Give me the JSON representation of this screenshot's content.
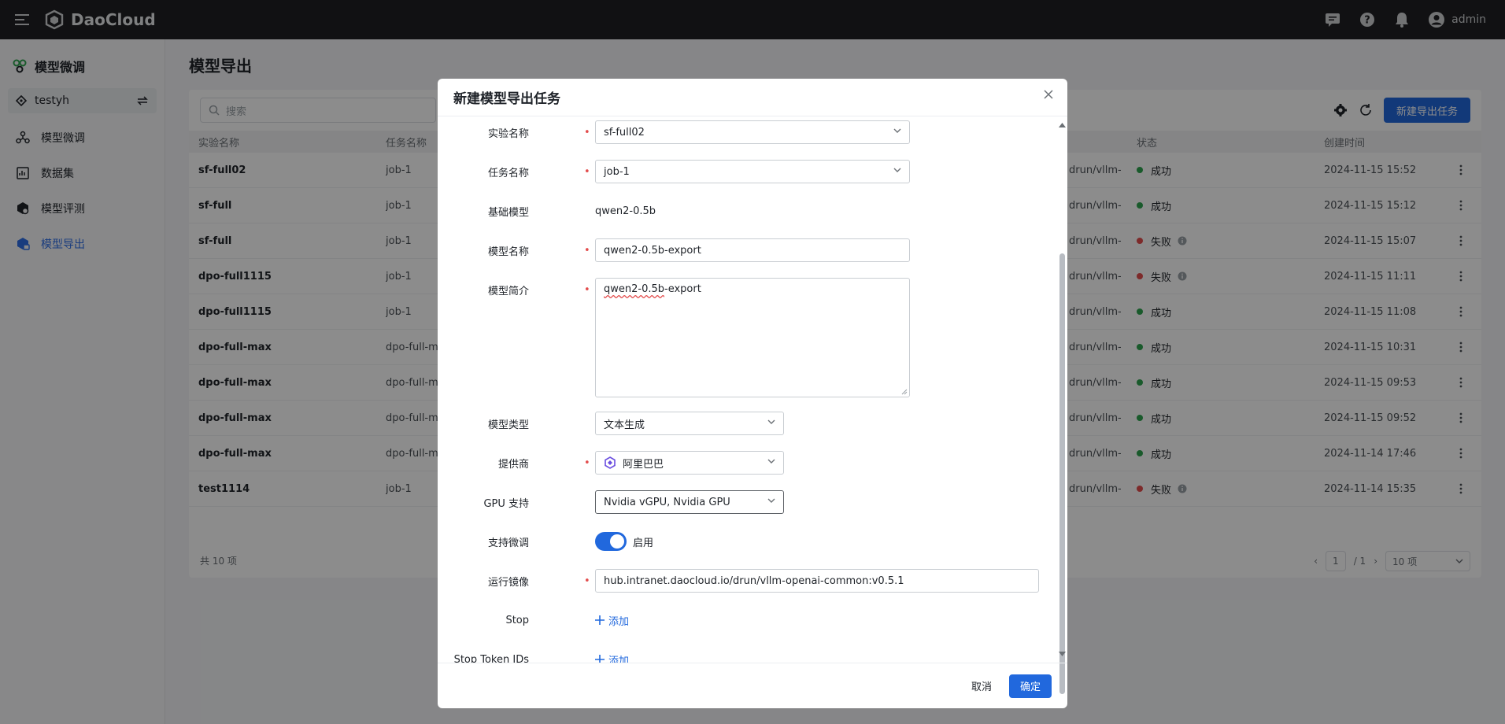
{
  "topbar": {
    "brand": "DaoCloud",
    "user": "admin"
  },
  "sidebar": {
    "title": "模型微调",
    "workspace": "testyh",
    "items": [
      {
        "label": "模型微调"
      },
      {
        "label": "数据集"
      },
      {
        "label": "模型评测"
      },
      {
        "label": "模型导出"
      }
    ]
  },
  "page": {
    "title": "模型导出",
    "search_placeholder": "搜索",
    "new_button": "新建导出任务",
    "columns": {
      "experiment": "实验名称",
      "task": "任务名称",
      "status": "状态",
      "created": "创建时间"
    },
    "rows": [
      {
        "experiment": "sf-full02",
        "task": "job-1",
        "image": "drun/vllm-...",
        "status": "成功",
        "status_color": "#2ea44f",
        "created": "2024-11-15 15:52",
        "info": false
      },
      {
        "experiment": "sf-full",
        "task": "job-1",
        "image": "drun/vllm-...",
        "status": "成功",
        "status_color": "#2ea44f",
        "created": "2024-11-15 15:12",
        "info": false
      },
      {
        "experiment": "sf-full",
        "task": "job-1",
        "image": "drun/vllm-...",
        "status": "失败",
        "status_color": "#e34d4d",
        "created": "2024-11-15 15:07",
        "info": true
      },
      {
        "experiment": "dpo-full1115",
        "task": "job-1",
        "image": "drun/vllm-...",
        "status": "失败",
        "status_color": "#e34d4d",
        "created": "2024-11-15 11:11",
        "info": true
      },
      {
        "experiment": "dpo-full1115",
        "task": "job-1",
        "image": "drun/vllm-...",
        "status": "成功",
        "status_color": "#2ea44f",
        "created": "2024-11-15 11:08",
        "info": false
      },
      {
        "experiment": "dpo-full-max",
        "task": "dpo-full-ma",
        "image": "drun/vllm-...",
        "status": "成功",
        "status_color": "#2ea44f",
        "created": "2024-11-15 10:31",
        "info": false
      },
      {
        "experiment": "dpo-full-max",
        "task": "dpo-full-ma",
        "image": "drun/vllm-...",
        "status": "成功",
        "status_color": "#2ea44f",
        "created": "2024-11-15 09:53",
        "info": false
      },
      {
        "experiment": "dpo-full-max",
        "task": "dpo-full-ma",
        "image": "drun/vllm-...",
        "status": "成功",
        "status_color": "#2ea44f",
        "created": "2024-11-15 09:52",
        "info": false
      },
      {
        "experiment": "dpo-full-max",
        "task": "dpo-full-ma",
        "image": "drun/vllm-...",
        "status": "成功",
        "status_color": "#2ea44f",
        "created": "2024-11-14 17:46",
        "info": false
      },
      {
        "experiment": "test1114",
        "task": "job-1",
        "image": "drun/vllm-...",
        "status": "失败",
        "status_color": "#e34d4d",
        "created": "2024-11-14 15:35",
        "info": true
      }
    ],
    "total": "共 10 项",
    "page_current": "1",
    "page_total": "/ 1",
    "page_size": "10 项"
  },
  "modal": {
    "title": "新建模型导出任务",
    "fields": {
      "experiment": {
        "label": "实验名称",
        "value": "sf-full02"
      },
      "task": {
        "label": "任务名称",
        "value": "job-1"
      },
      "base_model": {
        "label": "基础模型",
        "value": "qwen2-0.5b"
      },
      "model_name": {
        "label": "模型名称",
        "value": "qwen2-0.5b-export"
      },
      "model_desc": {
        "label": "模型简介",
        "value_a": "qwen2-0.5b",
        "value_b": "-export"
      },
      "model_type": {
        "label": "模型类型",
        "value": "文本生成"
      },
      "provider": {
        "label": "提供商",
        "value": "阿里巴巴"
      },
      "gpu": {
        "label": "GPU 支持",
        "value": "Nvidia vGPU, Nvidia GPU"
      },
      "finetune": {
        "label": "支持微调",
        "value": "启用",
        "enabled": true
      },
      "image": {
        "label": "运行镜像",
        "value": "hub.intranet.daocloud.io/drun/vllm-openai-common:v0.5.1"
      },
      "stop": {
        "label": "Stop",
        "add": "添加"
      },
      "stop_tokens": {
        "label": "Stop Token IDs",
        "add": "添加"
      }
    },
    "required_mark": "•",
    "cancel": "取消",
    "ok": "确定"
  },
  "colors": {
    "primary": "#2168dd",
    "success": "#2ea44f",
    "danger": "#e34d4d"
  }
}
